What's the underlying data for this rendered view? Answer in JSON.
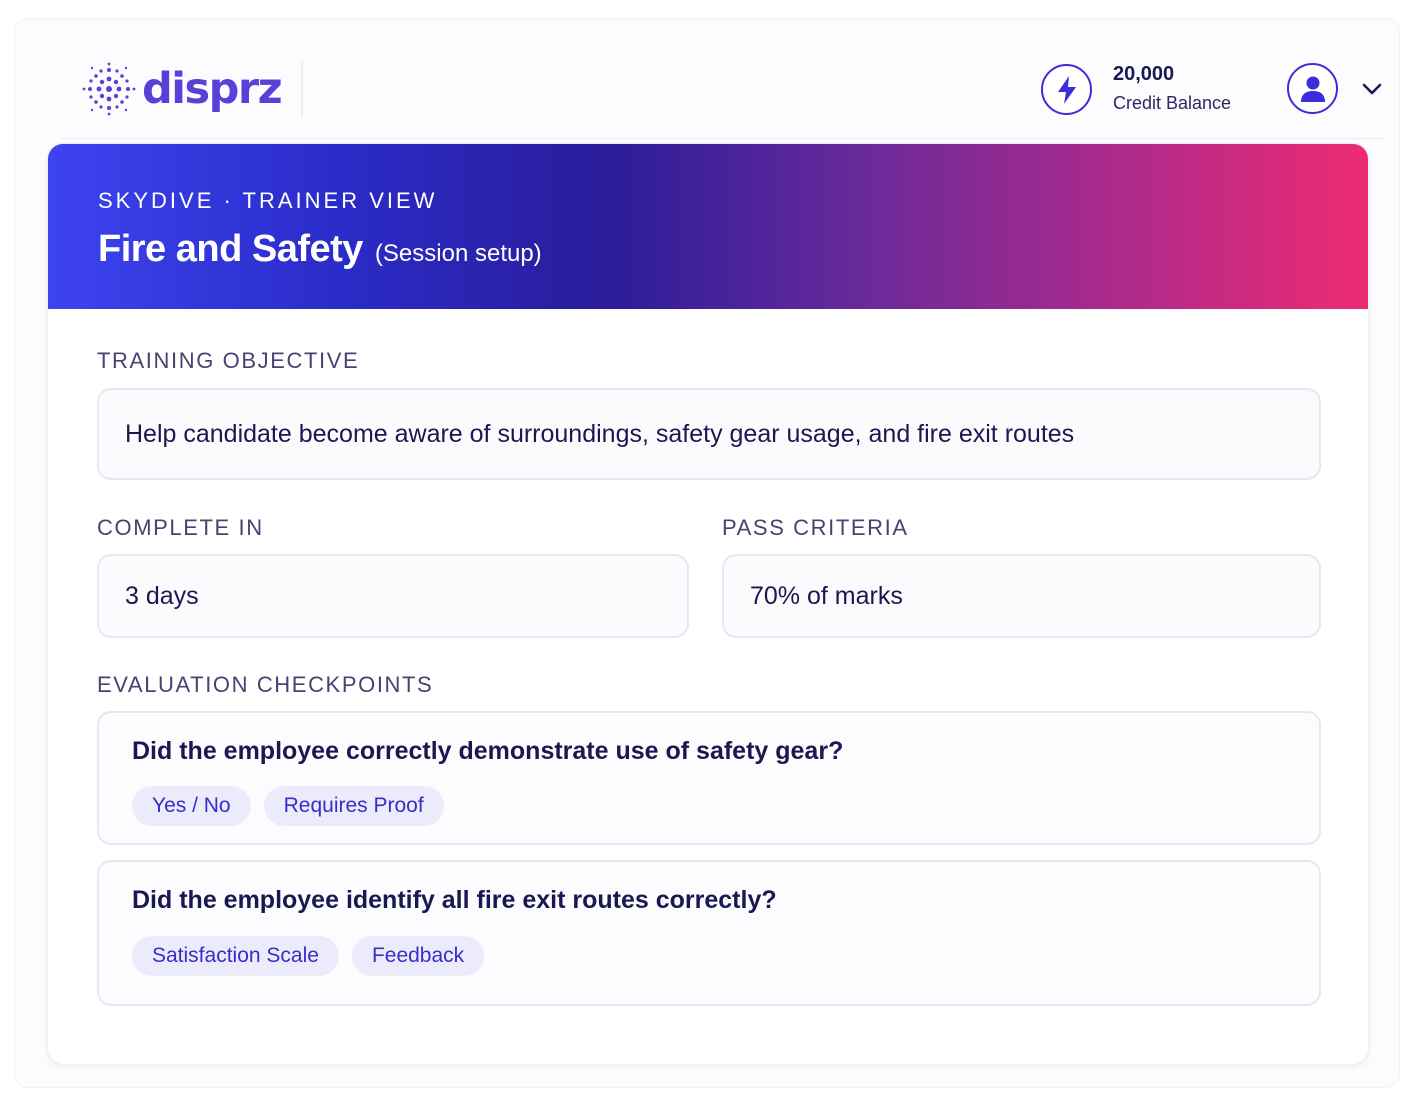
{
  "header": {
    "logo_text": "disprz",
    "credit_amount": "20,000",
    "credit_label": "Credit Balance",
    "icons": [
      "lightning-icon",
      "user-icon",
      "chevron-down-icon"
    ]
  },
  "banner": {
    "eyebrow": "SKYDIVE · TRAINER VIEW",
    "title": "Fire and Safety",
    "subtitle": "(Session setup)"
  },
  "training_objective": {
    "label": "TRAINING OBJECTIVE",
    "value": "Help candidate become aware of surroundings, safety gear usage, and fire exit routes"
  },
  "complete_in": {
    "label": "COMPLETE IN",
    "value": "3 days"
  },
  "pass_criteria": {
    "label": "PASS CRITERIA",
    "value": "70% of marks"
  },
  "evaluation": {
    "label": "EVALUATION CHECKPOINTS",
    "checkpoints": [
      {
        "question": "Did the employee correctly demonstrate use of safety gear?",
        "tags": [
          "Yes / No",
          "Requires Proof"
        ]
      },
      {
        "question": "Did the employee identify all fire exit routes correctly?",
        "tags": [
          "Satisfaction Scale",
          "Feedback"
        ]
      }
    ]
  },
  "colors": {
    "brand": "#5b3fd6",
    "accent": "#3d2cd9",
    "banner_start": "#3d44f0",
    "banner_end": "#ee2b72",
    "tag_bg": "#ecebfb",
    "tag_text": "#3a2cc8"
  }
}
